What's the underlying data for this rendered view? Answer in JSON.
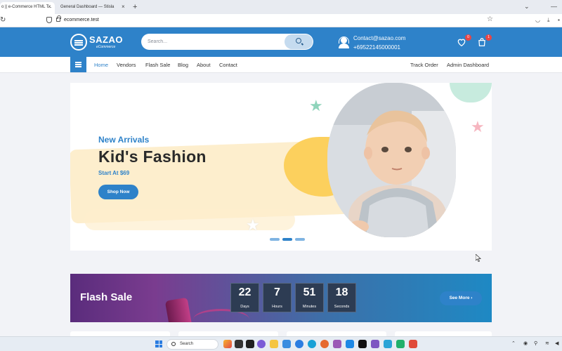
{
  "browser": {
    "tabs": [
      {
        "title": "o || e-Commerce HTML T..."
      },
      {
        "title": "General Dashboard — Stisla"
      }
    ],
    "new_tab": "+",
    "url": "ecommerce.test",
    "reload_icon": "reload-icon",
    "bookmark_icon": "star-icon"
  },
  "header": {
    "logo_name": "SAZAO",
    "logo_sub": "eCommerce",
    "search_placeholder": "Search...",
    "contact_email": "Contact@sazao.com",
    "contact_phone": "+69522145000001",
    "wishlist_count": "0",
    "cart_count": "1",
    "brand_color": "#2e82c9"
  },
  "nav": {
    "links": [
      "Home",
      "Vendors",
      "Flash Sale",
      "Blog",
      "About",
      "Contact"
    ],
    "right_links": [
      "Track Order",
      "Admin Dashboard"
    ]
  },
  "hero": {
    "kicker": "New Arrivals",
    "title": "Kid's Fashion",
    "price": "Start At $69",
    "cta": "Shop Now",
    "slides_total": 3,
    "active_slide": 2
  },
  "flash_sale": {
    "title": "Flash Sale",
    "countdown": [
      {
        "value": "22",
        "label": "Days"
      },
      {
        "value": "7",
        "label": "Hours"
      },
      {
        "value": "51",
        "label": "Minutes"
      },
      {
        "value": "18",
        "label": "Seconds"
      }
    ],
    "cta": "See More ›"
  },
  "taskbar": {
    "search_label": "Search"
  }
}
